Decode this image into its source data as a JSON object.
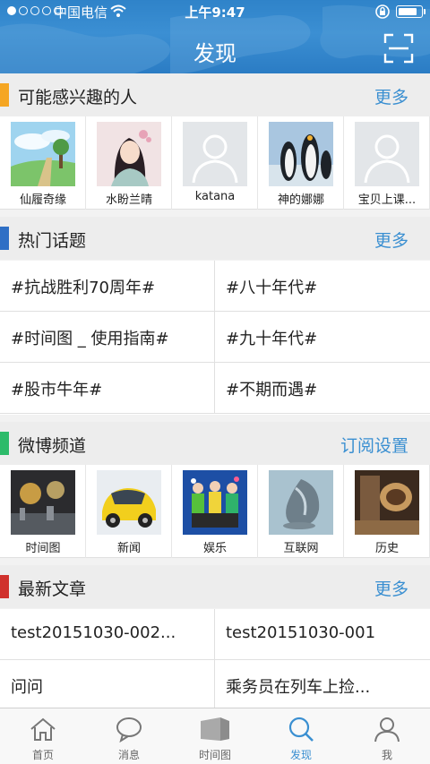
{
  "status_bar": {
    "carrier": "中国电信",
    "time": "上午9:47",
    "battery_level": 0.85
  },
  "header": {
    "title": "发现"
  },
  "people": {
    "title": "可能感兴趣的人",
    "more": "更多",
    "accent": "#f5a623",
    "items": [
      {
        "name": "仙履奇缘"
      },
      {
        "name": "水盼兰晴"
      },
      {
        "name": "katana"
      },
      {
        "name": "神的娜娜"
      },
      {
        "name": "宝贝上课..."
      }
    ]
  },
  "topics": {
    "title": "热门话题",
    "more": "更多",
    "accent": "#2f6fc5",
    "items": [
      {
        "label": "#抗战胜利70周年#"
      },
      {
        "label": "#八十年代#"
      },
      {
        "label": "#时间图 _ 使用指南#"
      },
      {
        "label": "#九十年代#"
      },
      {
        "label": "#股市牛年#"
      },
      {
        "label": "#不期而遇#"
      }
    ]
  },
  "channels": {
    "title": "微博频道",
    "more": "订阅设置",
    "accent": "#2dbb6a",
    "items": [
      {
        "name": "时间图"
      },
      {
        "name": "新闻"
      },
      {
        "name": "娱乐"
      },
      {
        "name": "互联网"
      },
      {
        "name": "历史"
      }
    ]
  },
  "articles": {
    "title": "最新文章",
    "more": "更多",
    "accent": "#d0312d",
    "items": [
      {
        "label": "test20151030-002..."
      },
      {
        "label": "test20151030-001"
      },
      {
        "label": "问问"
      },
      {
        "label": "乘务员在列车上捡..."
      }
    ]
  },
  "tabbar": {
    "active": "发现",
    "items": [
      {
        "label": "首页",
        "icon": "home-icon"
      },
      {
        "label": "消息",
        "icon": "message-icon"
      },
      {
        "label": "时间图",
        "icon": "timeline-icon"
      },
      {
        "label": "发现",
        "icon": "discover-icon"
      },
      {
        "label": "我",
        "icon": "profile-icon"
      }
    ]
  }
}
